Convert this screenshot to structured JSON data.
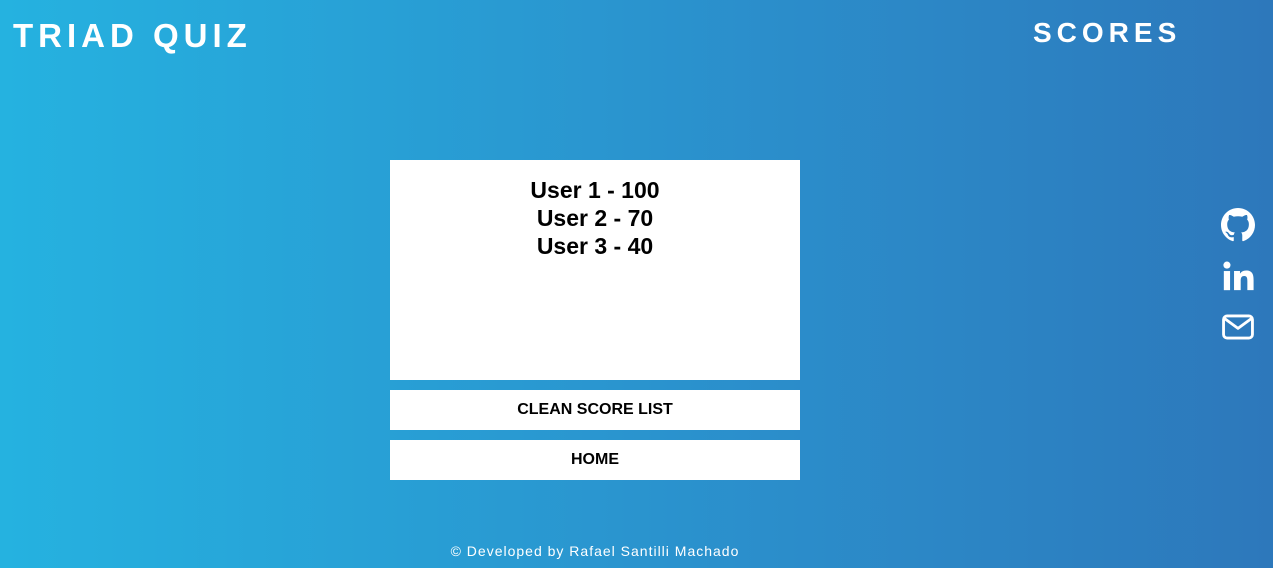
{
  "header": {
    "app_title": "TRIAD QUIZ",
    "page_heading": "SCORES"
  },
  "scores": [
    "User 1 - 100",
    "User 2 - 70",
    "User 3 - 40"
  ],
  "buttons": {
    "clean_label": "CLEAN SCORE LIST",
    "home_label": "HOME"
  },
  "social_icons": [
    "github-icon",
    "linkedin-icon",
    "mail-icon"
  ],
  "footer": {
    "text": "© Developed by Rafael Santilli Machado"
  },
  "colors": {
    "gradient_start": "#25b2e0",
    "gradient_end": "#2d78bb",
    "panel": "#ffffff",
    "text_dark": "#000000",
    "text_light": "#ffffff"
  }
}
